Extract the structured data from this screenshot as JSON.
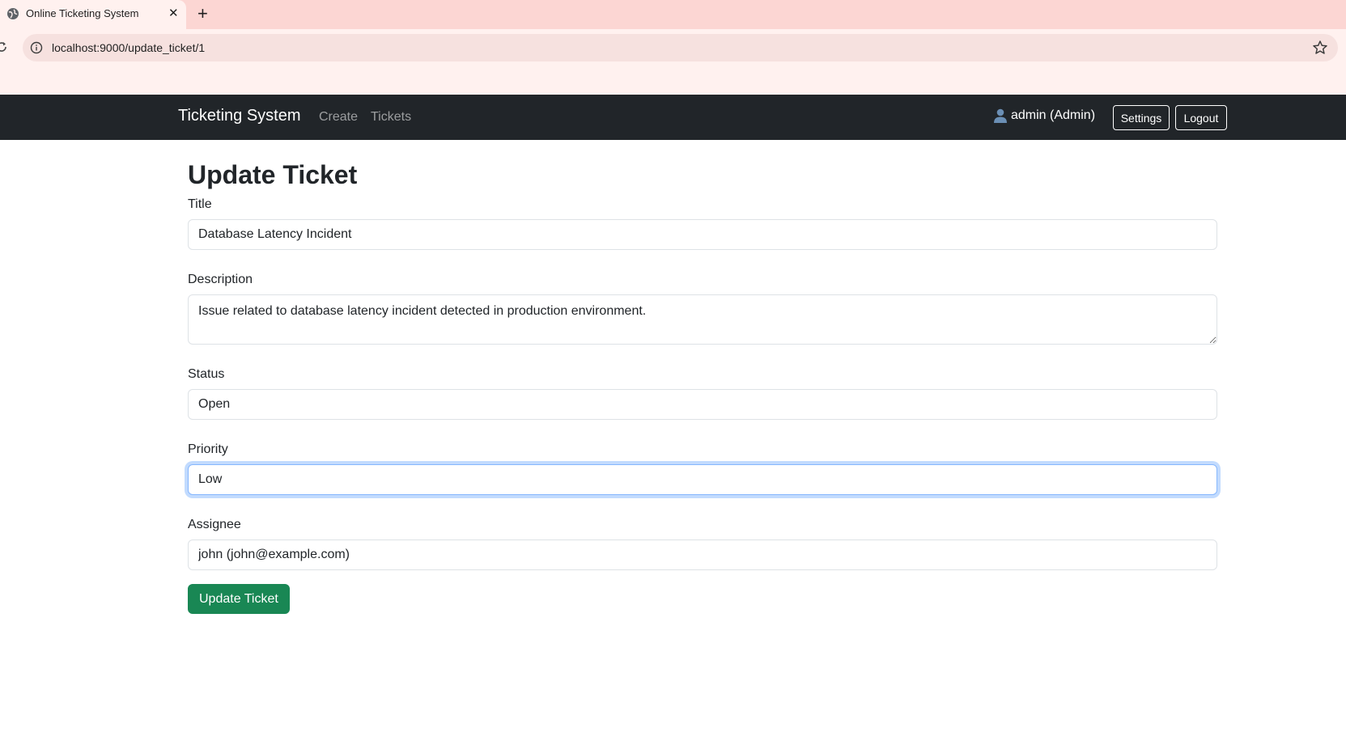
{
  "browser": {
    "tab_title": "Online Ticketing System",
    "url": "localhost:9000/update_ticket/1"
  },
  "navbar": {
    "brand": "Ticketing System",
    "links": [
      "Create",
      "Tickets"
    ],
    "user_label": "admin (Admin)",
    "settings_label": "Settings",
    "logout_label": "Logout"
  },
  "form": {
    "heading": "Update Ticket",
    "title_label": "Title",
    "title_value": "Database Latency Incident",
    "description_label": "Description",
    "description_value": "Issue related to database latency incident detected in production environment.",
    "status_label": "Status",
    "status_value": "Open",
    "priority_label": "Priority",
    "priority_value": "Low",
    "assignee_label": "Assignee",
    "assignee_value": "john (john@example.com)",
    "submit_label": "Update Ticket"
  },
  "colors": {
    "navbar_bg": "#212529",
    "submit_bg": "#198754",
    "focus_border": "#86b7fe",
    "tabstrip_bg": "#fcd6d3"
  },
  "icons": {
    "favicon": "globe-icon",
    "tab_close": "close-icon",
    "new_tab": "plus-icon",
    "reload": "reload-icon",
    "site_info": "info-icon",
    "bookmark": "star-icon",
    "user": "user-icon"
  }
}
